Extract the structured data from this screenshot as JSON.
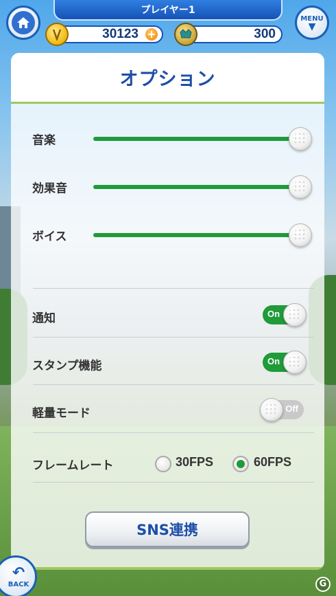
{
  "header": {
    "player_name": "プレイヤー1",
    "menu_label": "MENU",
    "coins": "30123",
    "gems": "300"
  },
  "panel": {
    "title": "オプション",
    "sliders": [
      {
        "label": "音楽",
        "level": 1.0
      },
      {
        "label": "効果音",
        "level": 1.0
      },
      {
        "label": "ボイス",
        "level": 1.0
      }
    ],
    "toggles": [
      {
        "label": "通知",
        "state": "On"
      },
      {
        "label": "スタンプ機能",
        "state": "On"
      },
      {
        "label": "軽量モード",
        "state": "Off"
      }
    ],
    "frame_rate": {
      "label": "フレームレート",
      "options": [
        "30FPS",
        "60FPS"
      ],
      "selected": "60FPS"
    },
    "sns_button": "SNS連携"
  },
  "back_label": "BACK",
  "icons": {
    "home": "home-icon",
    "menu": "chevron-down-icon",
    "coin": "coin-icon",
    "gem": "gem-icon",
    "plus": "plus-icon",
    "back": "back-arrow-icon"
  },
  "colors": {
    "accent_green": "#1f9b3a",
    "title_blue": "#1d4fa8",
    "header_blue": "#1652b8"
  }
}
